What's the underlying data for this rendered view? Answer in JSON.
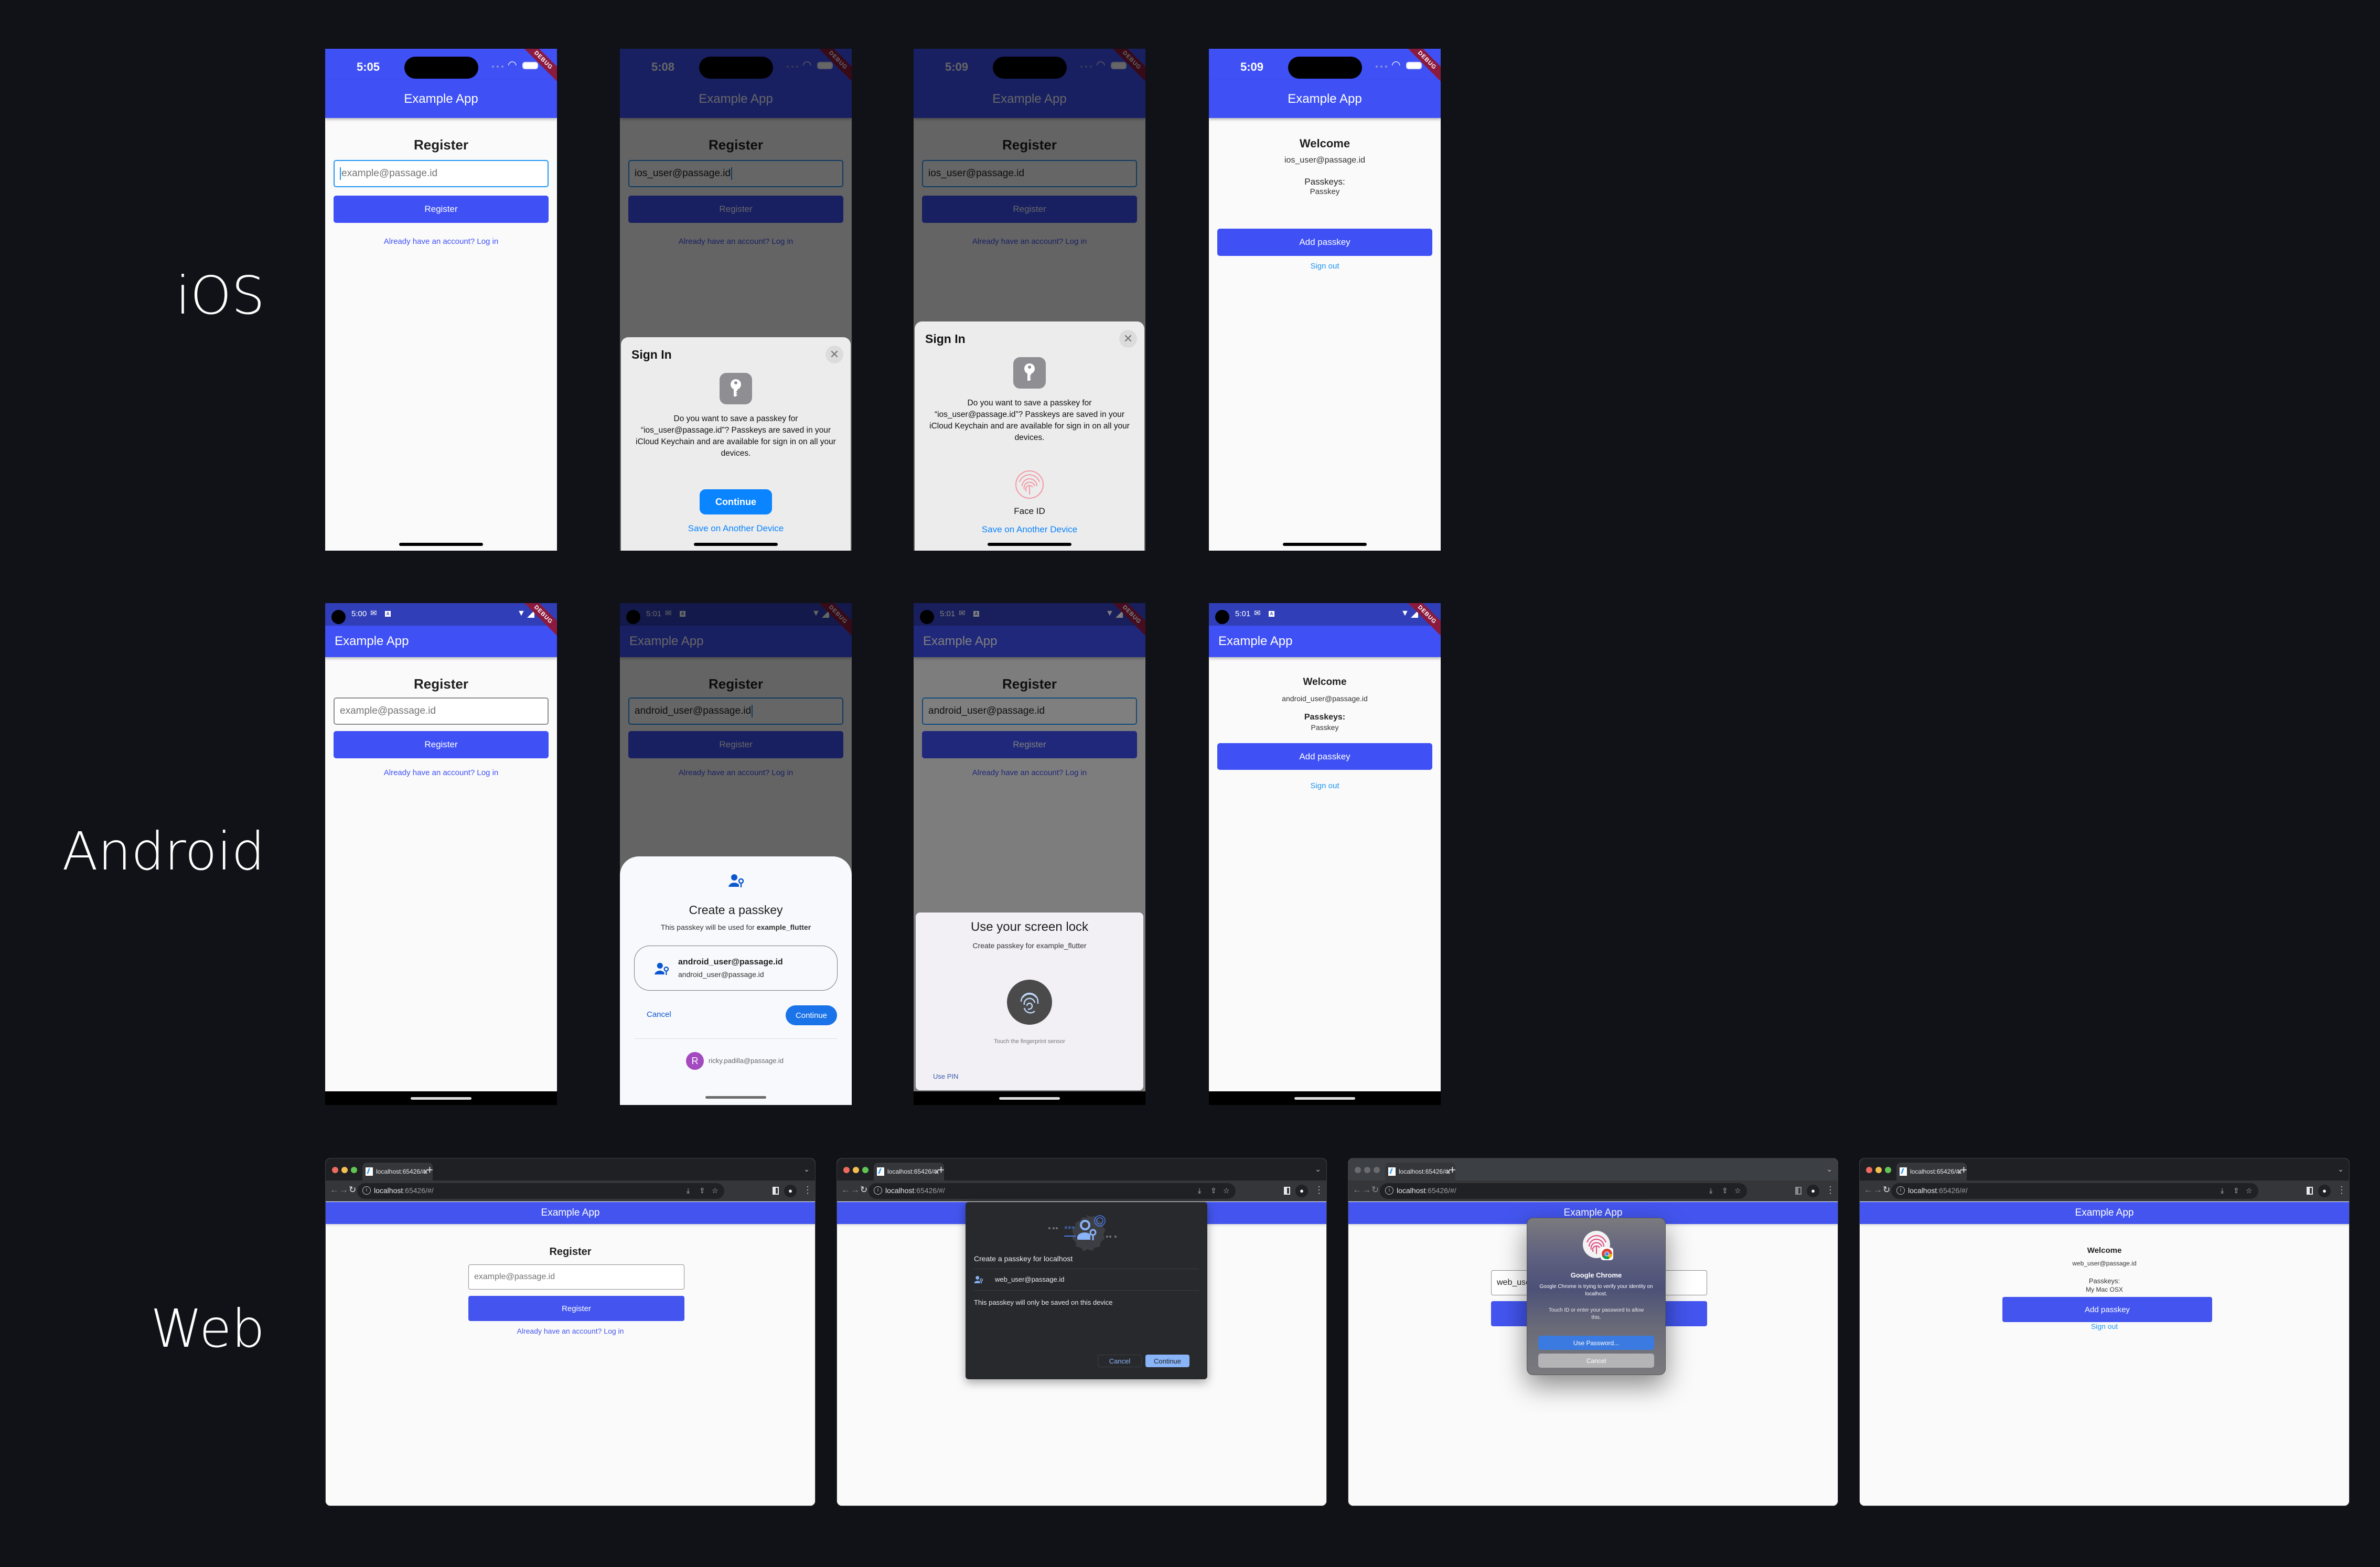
{
  "row_labels": {
    "ios": "iOS",
    "android": "Android",
    "web": "Web"
  },
  "colors": {
    "brand": "#3f51f5",
    "ios_blue": "#0a84ff",
    "android_blue": "#1a73e8",
    "link_blue": "#2196f3",
    "debug_ribbon": "#8b1a3e",
    "background": "#111217"
  },
  "common": {
    "app_title": "Example App",
    "debug_label": "DEBUG",
    "register_title": "Register",
    "email_placeholder": "example@passage.id",
    "register_button": "Register",
    "login_link": "Already have an account? Log in",
    "welcome_title": "Welcome",
    "passkeys_label": "Passkeys:",
    "add_passkey_button": "Add passkey",
    "sign_out_link": "Sign out"
  },
  "ios": {
    "screens": [
      {
        "time": "5:05",
        "email_value": ""
      },
      {
        "time": "5:08",
        "email_value": "ios_user@passage.id"
      },
      {
        "time": "5:09",
        "email_value": "ios_user@passage.id"
      },
      {
        "time": "5:09",
        "user_email": "ios_user@passage.id",
        "passkey_name": "Passkey"
      }
    ],
    "sheet": {
      "title": "Sign In",
      "close_icon": "close-icon",
      "key_icon": "key-icon",
      "message": "Do you want to save a passkey for “ios_user@passage.id”? Passkeys are saved in your iCloud Keychain and are available for sign in on all your devices.",
      "continue_button": "Continue",
      "face_id_label": "Face ID",
      "save_another_device": "Save on Another Device"
    }
  },
  "android": {
    "screens": [
      {
        "time": "5:00",
        "email_value": ""
      },
      {
        "time": "5:01",
        "email_value": "android_user@passage.id"
      },
      {
        "time": "5:01",
        "email_value": "android_user@passage.id"
      },
      {
        "time": "5:01",
        "user_email": "android_user@passage.id",
        "passkey_name": "Passkey"
      }
    ],
    "create_sheet": {
      "title": "Create a passkey",
      "subtitle_prefix": "This passkey will be used for ",
      "app_name": "example_flutter",
      "account_primary": "android_user@passage.id",
      "account_secondary": "android_user@passage.id",
      "cancel_button": "Cancel",
      "continue_button": "Continue",
      "account_avatar_letter": "R",
      "account_email": "ricky.padilla@passage.id"
    },
    "lock_sheet": {
      "title": "Use your screen lock",
      "subtitle": "Create passkey for example_flutter",
      "hint": "Touch the fingerprint sensor",
      "use_pin": "Use PIN"
    }
  },
  "web": {
    "tab_title": "localhost:65426/#/",
    "url_host": "localhost",
    "url_path": ":65426/#/",
    "screens": [
      {
        "email_value": ""
      },
      {
        "email_value": ""
      },
      {
        "email_value": "web_user@passage.id"
      },
      {
        "user_email": "web_user@passage.id",
        "passkey_name": "My Mac OSX"
      }
    ],
    "chrome_dialog": {
      "title": "Create a passkey for localhost",
      "account": "web_user@passage.id",
      "note": "This passkey will only be saved on this device",
      "cancel_button": "Cancel",
      "continue_button": "Continue"
    },
    "mac_dialog": {
      "title": "Google Chrome",
      "message": "Google Chrome is trying to verify your identity on localhost.",
      "instruction": "Touch ID or enter your password to allow this.",
      "use_password_button": "Use Password...",
      "cancel_button": "Cancel",
      "input_partial": "web_use"
    }
  }
}
